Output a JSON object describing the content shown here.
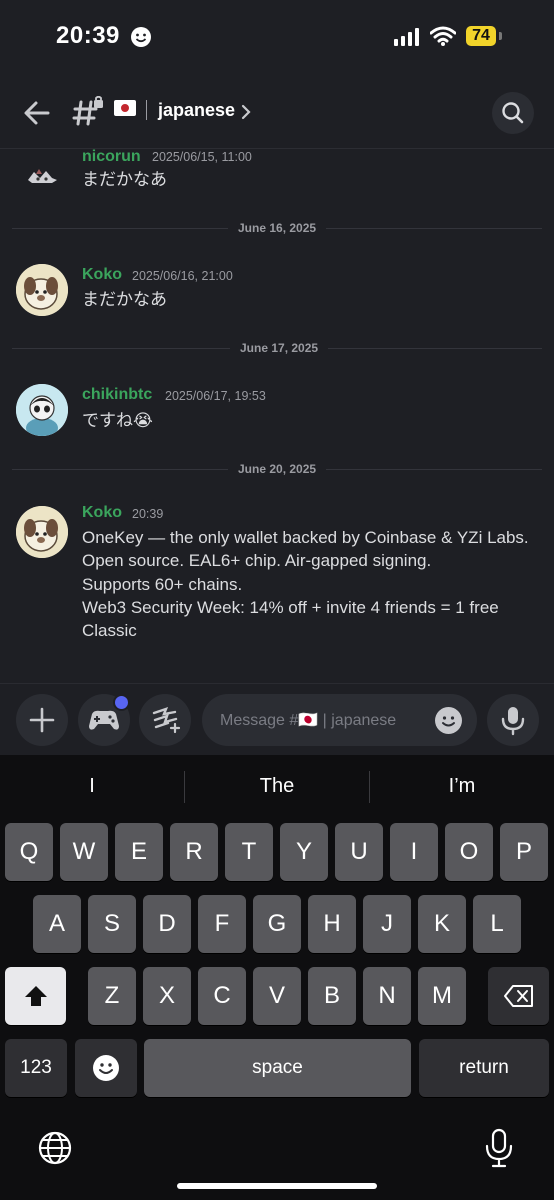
{
  "status_bar": {
    "time": "20:39",
    "battery": "74"
  },
  "header": {
    "channel_name": "japanese"
  },
  "dividers": [
    "June 16, 2025",
    "June 17, 2025",
    "June 20, 2025"
  ],
  "messages": [
    {
      "user": "nicorun",
      "timestamp": "2025/06/15, 11:00",
      "lines": [
        "まだかなあ"
      ]
    },
    {
      "user": "Koko",
      "timestamp": "2025/06/16, 21:00",
      "lines": [
        "まだかなあ"
      ]
    },
    {
      "user": "chikinbtc",
      "timestamp": "2025/06/17, 19:53",
      "lines": [
        "ですね😭"
      ]
    },
    {
      "user": "Koko",
      "timestamp": "20:39",
      "lines": [
        "OneKey — the only wallet backed by Coinbase & YZi Labs.",
        "Open source. EAL6+ chip. Air-gapped signing.",
        "Supports 60+ chains.",
        "Web3 Security Week: 14% off + invite 4 friends = 1 free",
        "Classic"
      ]
    }
  ],
  "composer": {
    "placeholder": "Message #🇯🇵 | japanese"
  },
  "keyboard": {
    "suggestions": [
      "I",
      "The",
      "I’m"
    ],
    "row1": [
      "Q",
      "W",
      "E",
      "R",
      "T",
      "Y",
      "U",
      "I",
      "O",
      "P"
    ],
    "row2": [
      "A",
      "S",
      "D",
      "F",
      "G",
      "H",
      "J",
      "K",
      "L"
    ],
    "row3": [
      "Z",
      "X",
      "C",
      "V",
      "B",
      "N",
      "M"
    ],
    "numbers_key": "123",
    "space_key": "space",
    "return_key": "return"
  },
  "colors": {
    "username": "#3ba55d",
    "accent_dot": "#5865f2",
    "background": "#1e1f24"
  }
}
